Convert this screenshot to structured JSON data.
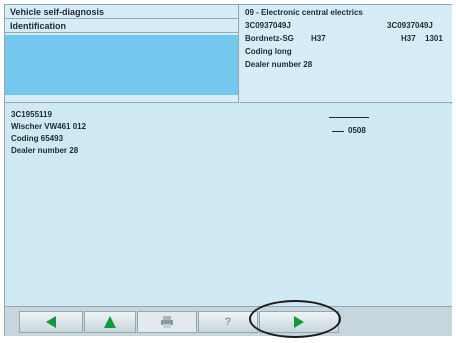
{
  "header_left": {
    "title": "Vehicle self-diagnosis",
    "subtitle": "Identification"
  },
  "header_right": {
    "module_title": "09 - Electronic central electrics",
    "part_number_1": "3C0937049J",
    "part_number_2": "3C0937049J",
    "component_name": "Bordnetz-SG",
    "version_1": "H37",
    "version_2": "H37",
    "version_3": "1301",
    "coding_text": "Coding long",
    "dealer_text": "Dealer number 28"
  },
  "content": {
    "line1": "3C1955119",
    "line2": "Wischer VW461 012",
    "line3": "Coding 65493",
    "line4": "Dealer number 28",
    "right_value": "0508"
  },
  "toolbar": {
    "back_icon": "arrow-left-icon",
    "up_icon": "arrow-up-icon",
    "print_icon": "printer-icon",
    "help_label": "?",
    "forward_icon": "arrow-right-icon",
    "accent_color": "#0f9a3c"
  }
}
